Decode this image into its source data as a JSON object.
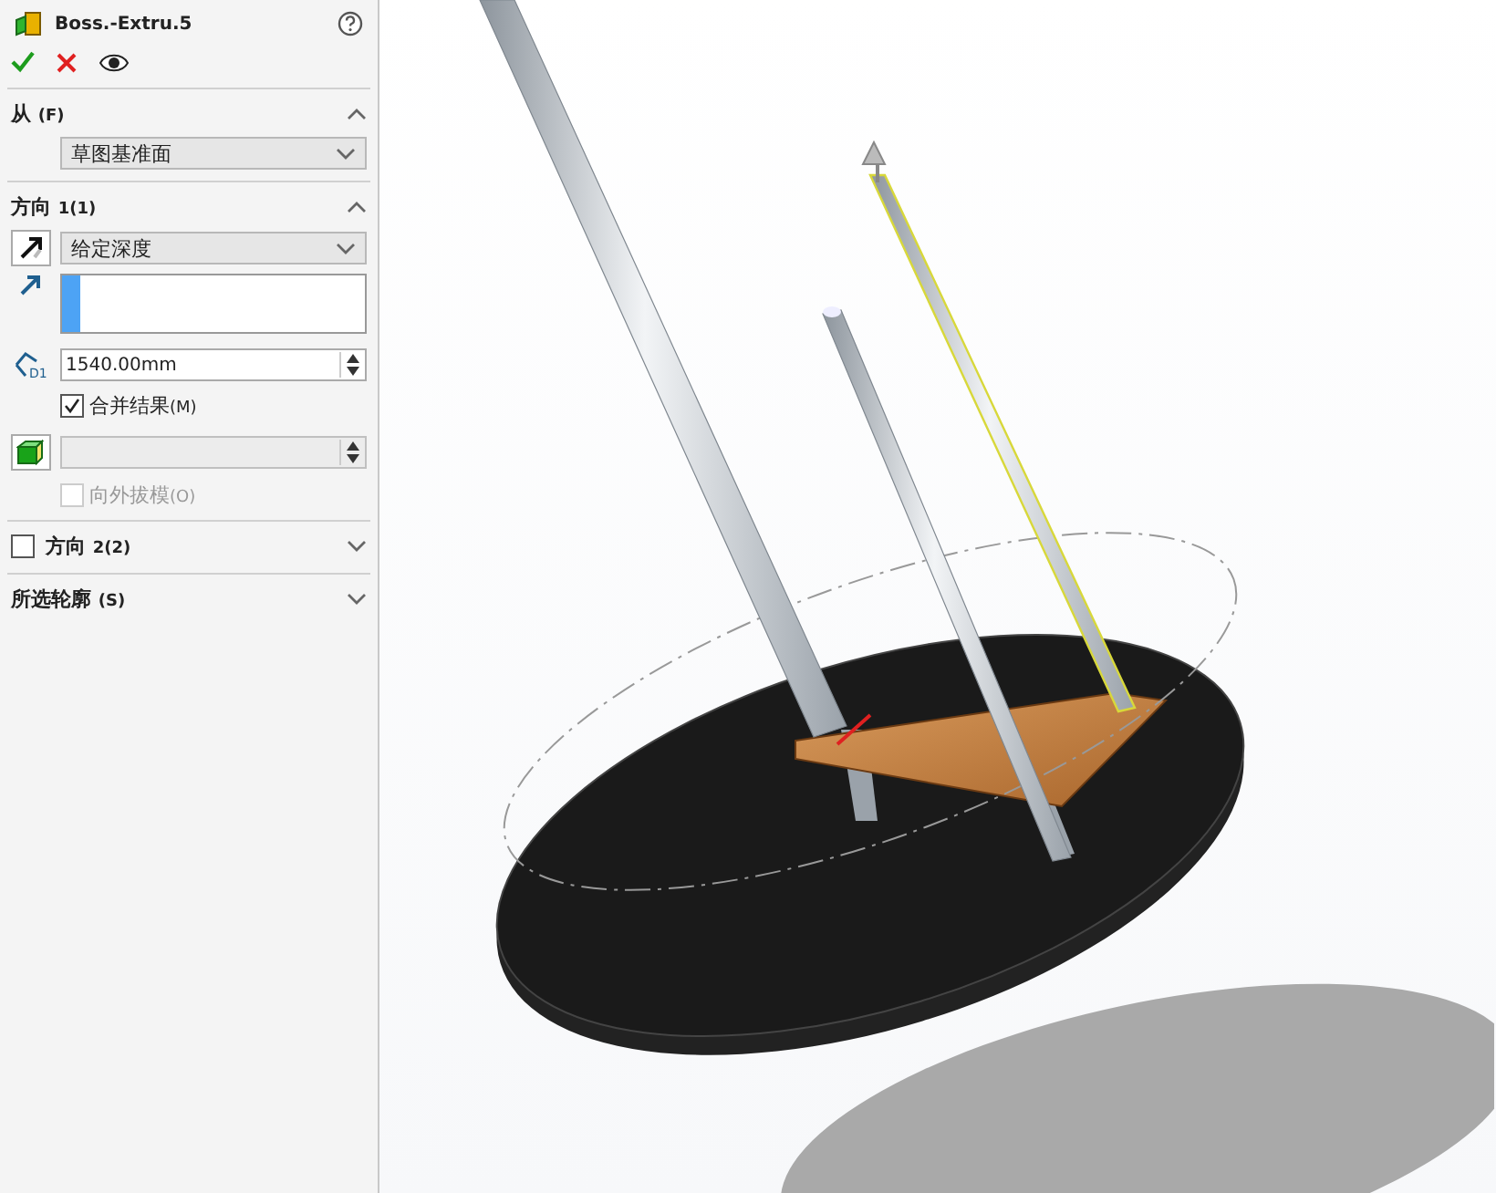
{
  "feature": {
    "title": "Boss.-Extru.5"
  },
  "sections": [
    {
      "kind": "from",
      "label": "从",
      "key": "(F)",
      "expanded": true,
      "dropdown": "草图基准面"
    },
    {
      "kind": "direction",
      "label": "方向",
      "key": "1(1)",
      "expanded": true,
      "end_condition": "给定深度",
      "depth": "1540.00mm",
      "dimension_label": "D1",
      "options": [
        {
          "label": "合并结果",
          "key": "(M)",
          "checked": true,
          "disabled": false
        },
        {
          "label": "向外拔模",
          "key": "(O)",
          "checked": false,
          "disabled": true
        }
      ]
    },
    {
      "kind": "toggle",
      "label": "方向",
      "key": "2(2)",
      "checked": false,
      "expanded": false
    },
    {
      "kind": "plain",
      "label": "所选轮廓",
      "key": "(S)",
      "expanded": false
    }
  ]
}
